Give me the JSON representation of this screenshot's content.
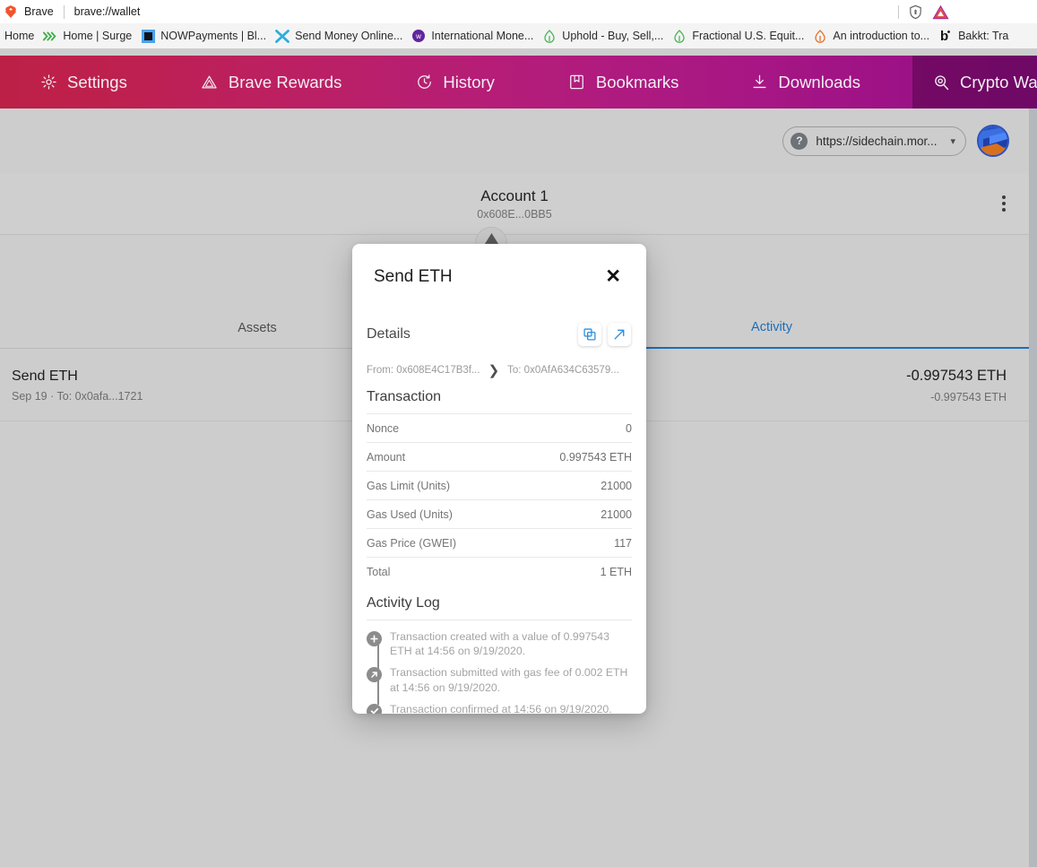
{
  "browser": {
    "brand": "Brave",
    "url": "brave://wallet",
    "bookmarks": [
      {
        "label": "Home",
        "icon": "page-icon"
      },
      {
        "label": "Home | Surge",
        "icon": "surge-chevrons-icon"
      },
      {
        "label": "NOWPayments | Bl...",
        "icon": "nowpayments-square-icon"
      },
      {
        "label": "Send Money Online...",
        "icon": "x-logo-icon"
      },
      {
        "label": "International Mone...",
        "icon": "w-circle-icon"
      },
      {
        "label": "Uphold - Buy, Sell,...",
        "icon": "uphold-icon"
      },
      {
        "label": "Fractional U.S. Equit...",
        "icon": "uphold-icon"
      },
      {
        "label": "An introduction to...",
        "icon": "orange-drop-icon"
      },
      {
        "label": "Bakkt: Tra",
        "icon": "bakkt-b-icon"
      }
    ]
  },
  "nav": {
    "items": [
      {
        "label": "Settings",
        "icon": "gear-icon",
        "active": false
      },
      {
        "label": "Brave Rewards",
        "icon": "triangle-icon",
        "active": false
      },
      {
        "label": "History",
        "icon": "clock-icon",
        "active": false
      },
      {
        "label": "Bookmarks",
        "icon": "book-icon",
        "active": false
      },
      {
        "label": "Downloads",
        "icon": "download-icon",
        "active": false
      },
      {
        "label": "Crypto Wallets",
        "icon": "wallet-icon",
        "active": true
      }
    ],
    "gradient_from": "#bd2046",
    "gradient_to": "#950f88"
  },
  "wallet": {
    "network_label": "https://sidechain.mor...",
    "account_name": "Account 1",
    "account_address": "0x608E...0BB5",
    "tabs": [
      {
        "label": "Assets",
        "active": false
      },
      {
        "label": "Activity",
        "active": true
      }
    ],
    "accent_color": "#1d6fb8",
    "transaction": {
      "title": "Send ETH",
      "subtitle": "Sep 19 · To: 0x0afa...1721",
      "amount": "-0.997543 ETH",
      "fiat": "-0.997543 ETH"
    }
  },
  "modal": {
    "title": "Send ETH",
    "close_label": "✕",
    "details_label": "Details",
    "copy_icon": "copy-icon",
    "external_icon": "external-link-icon",
    "from_address": "From: 0x608E4C17B3f...",
    "to_address": "To: 0x0AfA634C63579...",
    "transaction_heading": "Transaction",
    "rows": [
      {
        "key": "Nonce",
        "value": "0"
      },
      {
        "key": "Amount",
        "value": "0.997543 ETH"
      },
      {
        "key": "Gas Limit (Units)",
        "value": "21000"
      },
      {
        "key": "Gas Used (Units)",
        "value": "21000"
      },
      {
        "key": "Gas Price (GWEI)",
        "value": "117"
      },
      {
        "key": "Total",
        "value": "1 ETH"
      }
    ],
    "activity_heading": "Activity Log",
    "activity": [
      {
        "icon": "plus-circle-icon",
        "text": "Transaction created with a value of 0.997543 ETH at 14:56 on 9/19/2020."
      },
      {
        "icon": "arrow-up-right-circle-icon",
        "text": "Transaction submitted with gas fee of 0.002 ETH at 14:56 on 9/19/2020."
      },
      {
        "icon": "check-circle-icon",
        "text": "Transaction confirmed at 14:56 on 9/19/2020."
      }
    ]
  }
}
